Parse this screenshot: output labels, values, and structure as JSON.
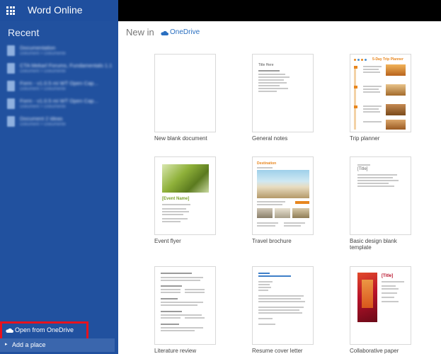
{
  "app": {
    "title": "Word Online"
  },
  "sidebar": {
    "recent_heading": "Recent",
    "recent_items": [
      {
        "name": "Documentation",
        "path": "Dokument > Dokumente"
      },
      {
        "name": "CTA Mekarl Forums, Fundamentals 1.1",
        "path": "Dokument > Dokumente"
      },
      {
        "name": "Form - v1.0.5 mi WT Open Cap...",
        "path": "Dokument > Dokumente"
      },
      {
        "name": "Form - v1.0.5 mi WT Open Cap...",
        "path": "Dokument > Dokumente"
      },
      {
        "name": "Document 2 ideas",
        "path": "Dokument > Dokumente"
      }
    ],
    "open_onedrive": "Open from OneDrive",
    "add_place": "Add a place"
  },
  "main": {
    "new_in": "New in",
    "location": "OneDrive",
    "templates": [
      {
        "label": "New blank document"
      },
      {
        "label": "General notes",
        "thumb_title": "Title Here"
      },
      {
        "label": "Trip planner",
        "thumb_title": "5-Day Trip Planner"
      },
      {
        "label": "Event flyer",
        "thumb_title": "[Event Name]"
      },
      {
        "label": "Travel brochure",
        "thumb_title": "Destination"
      },
      {
        "label": "Basic design blank",
        "label2": "template",
        "thumb_title": "[Title]"
      },
      {
        "label": "Literature review"
      },
      {
        "label": "Resume cover letter"
      },
      {
        "label": "Collaborative paper",
        "thumb_title": "[Title]"
      }
    ]
  },
  "colors": {
    "sidebar": "#21519f",
    "topbar": "#000000",
    "highlight": "#e8121d",
    "accent": "#2a6fc0",
    "trip_orange": "#e8861e",
    "event_green": "#7aa22c",
    "collab_red": "#b8122a"
  },
  "icons": [
    "app-launcher-icon",
    "onedrive-cloud-icon",
    "document-icon",
    "plus-icon"
  ]
}
